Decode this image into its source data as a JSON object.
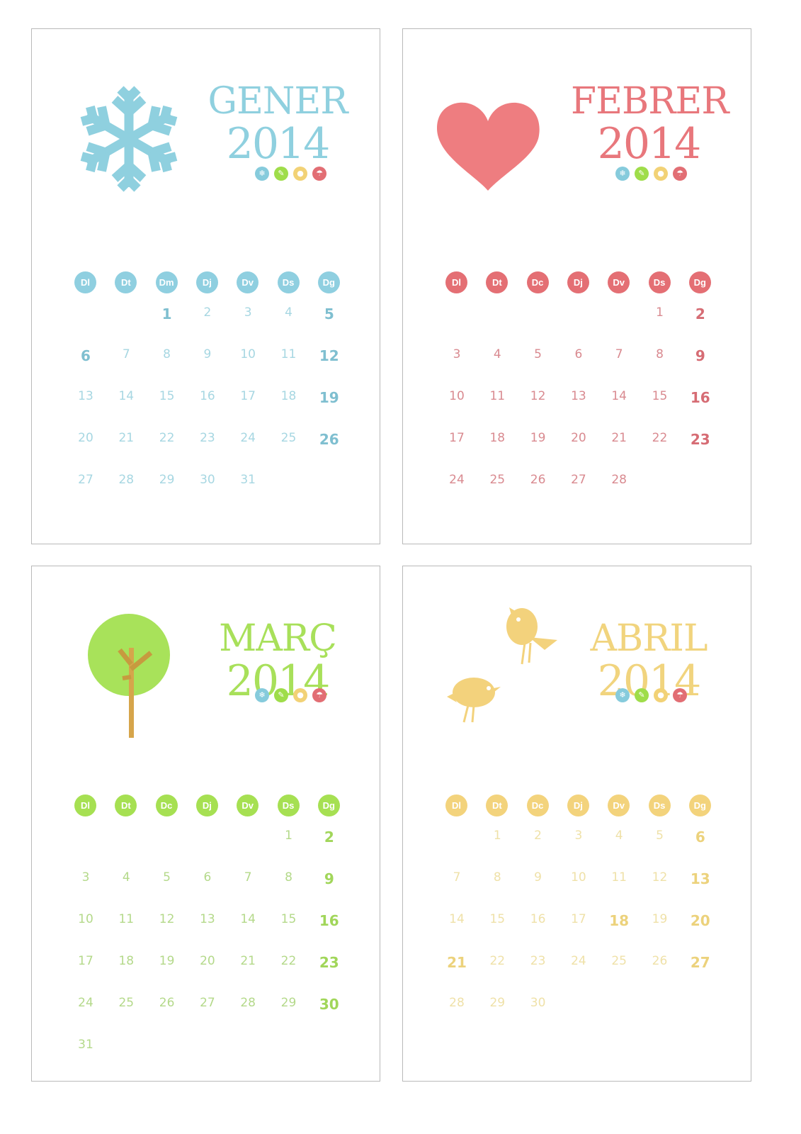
{
  "weekday_headers": {
    "gener": [
      "Dl",
      "Dt",
      "Dm",
      "Dj",
      "Dv",
      "Ds",
      "Dg"
    ],
    "others": [
      "Dl",
      "Dt",
      "Dc",
      "Dj",
      "Dv",
      "Ds",
      "Dg"
    ]
  },
  "season_icons": [
    {
      "name": "snowflake-icon",
      "glyph": "❄",
      "color": "#86cbdc"
    },
    {
      "name": "leaf-icon",
      "glyph": "✎",
      "color": "#9fdd4a"
    },
    {
      "name": "sun-icon",
      "glyph": "●",
      "color": "#f2d276"
    },
    {
      "name": "umbrella-icon",
      "glyph": "☂",
      "color": "#e26e74"
    }
  ],
  "months": [
    {
      "key": "gener",
      "name": "GENER",
      "year": "2014",
      "illustration": "snowflake",
      "color": "#8fd0df",
      "header_color": "#8fcfe0",
      "day_color": "#a7d7e2",
      "bold_color": "#7fbfd0",
      "headers": [
        "Dl",
        "Dt",
        "Dm",
        "Dj",
        "Dv",
        "Ds",
        "Dg"
      ],
      "weeks": [
        [
          null,
          null,
          "1",
          "2",
          "3",
          "4",
          "5"
        ],
        [
          "6",
          "7",
          "8",
          "9",
          "10",
          "11",
          "12"
        ],
        [
          "13",
          "14",
          "15",
          "16",
          "17",
          "18",
          "19"
        ],
        [
          "20",
          "21",
          "22",
          "23",
          "24",
          "25",
          "26"
        ],
        [
          "27",
          "28",
          "29",
          "30",
          "31",
          null,
          null
        ]
      ],
      "highlighted": [
        "1",
        "5",
        "6",
        "12",
        "19",
        "26"
      ]
    },
    {
      "key": "febrer",
      "name": "FEBRER",
      "year": "2014",
      "illustration": "heart",
      "color": "#e8777c",
      "header_color": "#e46f74",
      "day_color": "#d98a90",
      "bold_color": "#d66c74",
      "headers": [
        "Dl",
        "Dt",
        "Dc",
        "Dj",
        "Dv",
        "Ds",
        "Dg"
      ],
      "weeks": [
        [
          null,
          null,
          null,
          null,
          null,
          "1",
          "2"
        ],
        [
          "3",
          "4",
          "5",
          "6",
          "7",
          "8",
          "9"
        ],
        [
          "10",
          "11",
          "12",
          "13",
          "14",
          "15",
          "16"
        ],
        [
          "17",
          "18",
          "19",
          "20",
          "21",
          "22",
          "23"
        ],
        [
          "24",
          "25",
          "26",
          "27",
          "28",
          null,
          null
        ]
      ],
      "highlighted": [
        "2",
        "9",
        "16",
        "23"
      ]
    },
    {
      "key": "marc",
      "name": "MARÇ",
      "year": "2014",
      "illustration": "tree",
      "color": "#a8e05a",
      "header_color": "#a6e052",
      "day_color": "#b4d98a",
      "bold_color": "#a1d65a",
      "headers": [
        "Dl",
        "Dt",
        "Dc",
        "Dj",
        "Dv",
        "Ds",
        "Dg"
      ],
      "weeks": [
        [
          null,
          null,
          null,
          null,
          null,
          "1",
          "2"
        ],
        [
          "3",
          "4",
          "5",
          "6",
          "7",
          "8",
          "9"
        ],
        [
          "10",
          "11",
          "12",
          "13",
          "14",
          "15",
          "16"
        ],
        [
          "17",
          "18",
          "19",
          "20",
          "21",
          "22",
          "23"
        ],
        [
          "24",
          "25",
          "26",
          "27",
          "28",
          "29",
          "30"
        ],
        [
          "31",
          null,
          null,
          null,
          null,
          null,
          null
        ]
      ],
      "highlighted": [
        "2",
        "9",
        "16",
        "23",
        "30"
      ]
    },
    {
      "key": "abril",
      "name": "ABRIL",
      "year": "2014",
      "illustration": "birds",
      "color": "#f1d47e",
      "header_color": "#f3d37c",
      "day_color": "#efe1a8",
      "bold_color": "#ecd27c",
      "headers": [
        "Dl",
        "Dt",
        "Dc",
        "Dj",
        "Dv",
        "Ds",
        "Dg"
      ],
      "weeks": [
        [
          null,
          "1",
          "2",
          "3",
          "4",
          "5",
          "6"
        ],
        [
          "7",
          "8",
          "9",
          "10",
          "11",
          "12",
          "13"
        ],
        [
          "14",
          "15",
          "16",
          "17",
          "18",
          "19",
          "20"
        ],
        [
          "21",
          "22",
          "23",
          "24",
          "25",
          "26",
          "27"
        ],
        [
          "28",
          "29",
          "30",
          null,
          null,
          null,
          null
        ]
      ],
      "highlighted": [
        "6",
        "13",
        "18",
        "20",
        "21",
        "27"
      ]
    }
  ]
}
